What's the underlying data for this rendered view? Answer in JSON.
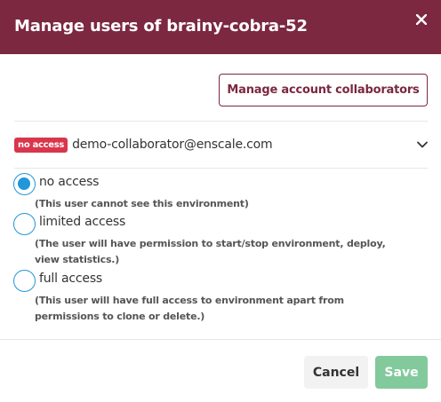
{
  "dialog": {
    "title": "Manage users of brainy-cobra-52",
    "close_icon": "close-icon"
  },
  "collaborators_button": {
    "label": "Manage account collaborators"
  },
  "user": {
    "badge": "no access",
    "email": "demo-collaborator@enscale.com",
    "expand_icon": "chevron-down-icon"
  },
  "access_options": [
    {
      "label": "no access",
      "description": "(This user cannot see this environment)",
      "selected": true
    },
    {
      "label": "limited access",
      "description": "(The user will have permission to start/stop environment, deploy, view statistics.)",
      "selected": false
    },
    {
      "label": "full access",
      "description": "(This user will have full access to environment apart from permissions to clone or delete.)",
      "selected": false
    }
  ],
  "footer": {
    "cancel_label": "Cancel",
    "save_label": "Save"
  },
  "colors": {
    "header_bg": "#7b2840",
    "accent_radio": "#2196d9",
    "badge_bg": "#d9364c",
    "save_bg": "#82c99c"
  }
}
